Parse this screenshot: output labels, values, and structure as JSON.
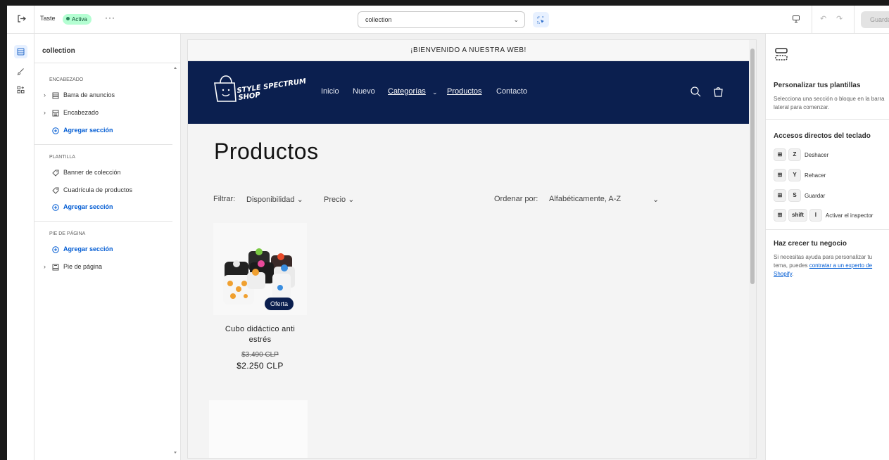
{
  "topbar": {
    "theme_name": "Taste",
    "status_badge": "Activa",
    "more_label": "···",
    "template_select": "collection",
    "save_label": "Guardar"
  },
  "rail": {
    "icons": [
      "sections-icon",
      "paintbrush-icon",
      "apps-icon"
    ]
  },
  "sidebar": {
    "title": "collection",
    "sections": [
      {
        "heading": "ENCABEZADO",
        "rows": [
          {
            "label": "Barra de anuncios",
            "icon": "announcement-icon",
            "type": "item"
          },
          {
            "label": "Encabezado",
            "icon": "header-icon",
            "type": "item"
          },
          {
            "label": "Agregar sección",
            "icon": "plus-circle-icon",
            "type": "add"
          }
        ]
      },
      {
        "heading": "PLANTILLA",
        "rows": [
          {
            "label": "Banner de colección",
            "icon": "tag-icon",
            "type": "item"
          },
          {
            "label": "Cuadrícula de productos",
            "icon": "tag-icon",
            "type": "item"
          },
          {
            "label": "Agregar sección",
            "icon": "plus-circle-icon",
            "type": "add"
          }
        ]
      },
      {
        "heading": "PIE DE PÁGINA",
        "rows": [
          {
            "label": "Agregar sección",
            "icon": "plus-circle-icon",
            "type": "add"
          },
          {
            "label": "Pie de página",
            "icon": "footer-icon",
            "type": "item"
          }
        ]
      }
    ]
  },
  "preview": {
    "announcement": "¡BIENVENIDO A NUESTRA WEB!",
    "logo_line1": "STYLE SPECTRUM",
    "logo_line2": "SHOP",
    "nav": [
      "Inicio",
      "Nuevo",
      "Categorías",
      "Productos",
      "Contacto"
    ],
    "page_title": "Productos",
    "filter_label": "Filtrar:",
    "filter_availability": "Disponibilidad",
    "filter_price": "Precio",
    "sort_label": "Ordenar por:",
    "sort_value": "Alfabéticamente, A-Z",
    "product": {
      "name": "Cubo didáctico anti estrés",
      "compare_price": "$3.490 CLP",
      "price": "$2.250 CLP",
      "badge": "Oferta"
    },
    "header_color": "#0b1f4f"
  },
  "right_panel": {
    "customize_title": "Personalizar tus plantillas",
    "customize_desc": "Selecciona una sección o bloque en la barra lateral para comenzar.",
    "shortcuts_title": "Accesos directos del teclado",
    "shortcuts": [
      {
        "keys": [
          "Z"
        ],
        "label": "Deshacer"
      },
      {
        "keys": [
          "Y"
        ],
        "label": "Rehacer"
      },
      {
        "keys": [
          "S"
        ],
        "label": "Guardar"
      },
      {
        "keys": [
          "shift",
          "I"
        ],
        "label": "Activar el inspector"
      }
    ],
    "grow_title": "Haz crecer tu negocio",
    "grow_desc_before": "Si necesitas ayuda para personalizar tu tema, puedes ",
    "grow_link": "contratar a un experto de Shopify",
    "grow_desc_after": "."
  }
}
